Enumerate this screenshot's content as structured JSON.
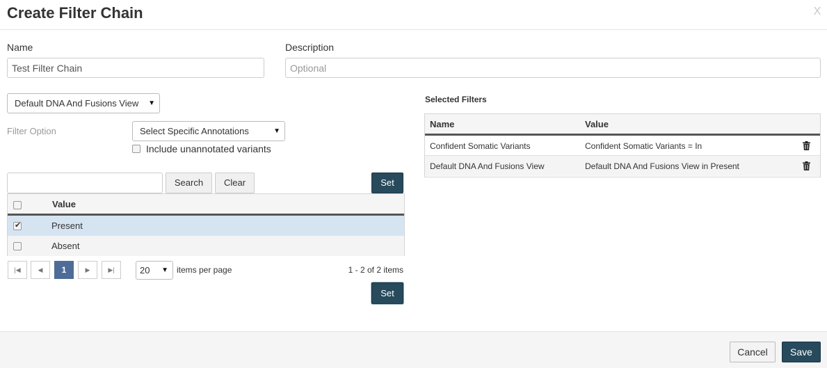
{
  "modal": {
    "title": "Create Filter Chain",
    "close_label": "X"
  },
  "form": {
    "name_label": "Name",
    "name_value": "Test Filter Chain",
    "description_label": "Description",
    "description_placeholder": "Optional"
  },
  "filter": {
    "view_select": "Default DNA And Fusions View",
    "option_label": "Filter Option",
    "option_select": "Select Specific Annotations",
    "include_unannotated_label": "Include unannotated variants",
    "include_unannotated_checked": false,
    "search_value": "",
    "search_button": "Search",
    "clear_button": "Clear",
    "set_button_top": "Set",
    "set_button_bottom": "Set"
  },
  "values_grid": {
    "header": "Value",
    "rows": [
      {
        "label": "Present",
        "checked": true
      },
      {
        "label": "Absent",
        "checked": false
      }
    ]
  },
  "pager": {
    "page": "1",
    "page_size": "20",
    "per_page_label": "items per page",
    "summary": "1 - 2 of 2 items"
  },
  "selected_filters": {
    "title": "Selected Filters",
    "col_name": "Name",
    "col_value": "Value",
    "rows": [
      {
        "name": "Confident Somatic Variants",
        "value": "Confident Somatic Variants = In"
      },
      {
        "name": "Default DNA And Fusions View",
        "value": "Default DNA And Fusions View in Present"
      }
    ]
  },
  "footer": {
    "cancel": "Cancel",
    "save": "Save"
  },
  "colors": {
    "primary_button": "#274a5c",
    "active_page": "#4e6c98",
    "selected_row": "#d6e4f2"
  }
}
